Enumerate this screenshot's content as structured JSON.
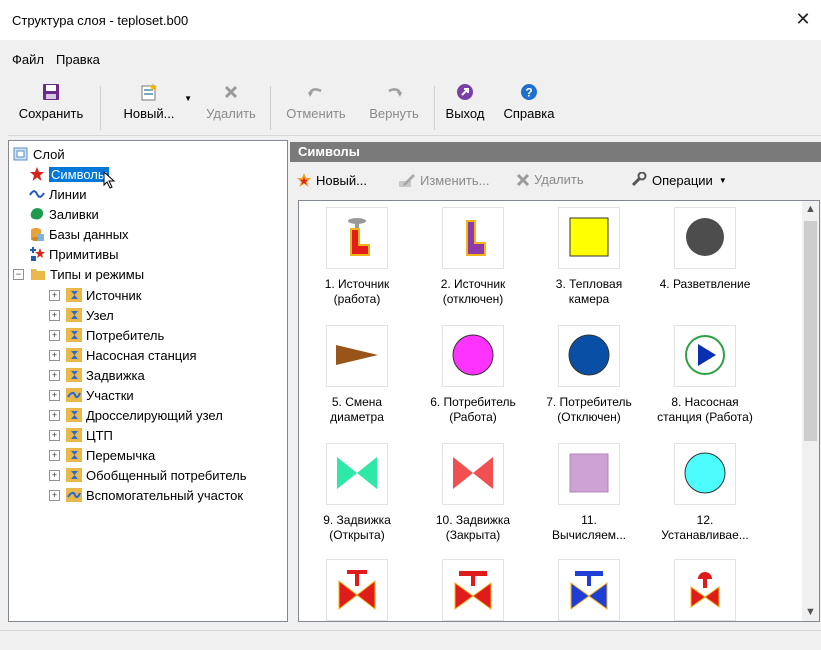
{
  "window": {
    "title": "Структура слоя - teploset.b00",
    "close_glyph": "✕"
  },
  "menu": [
    "Файл",
    "Правка"
  ],
  "toolbar": {
    "save": "Сохранить",
    "new": "Новый...",
    "delete": "Удалить",
    "undo": "Отменить",
    "redo": "Вернуть",
    "exit": "Выход",
    "help": "Справка"
  },
  "tree": {
    "root": "Слой",
    "items": [
      "Символы",
      "Линии",
      "Заливки",
      "Базы данных",
      "Примитивы",
      "Типы и режимы"
    ],
    "types": [
      "Источник",
      "Узел",
      "Потребитель",
      "Насосная станция",
      "Задвижка",
      "Участки",
      "Дросселирующий узел",
      "ЦТП",
      "Перемычка",
      "Обобщенный потребитель",
      "Вспомогательный участок"
    ]
  },
  "panel": {
    "header": "Символы",
    "new": "Новый...",
    "edit": "Изменить...",
    "delete": "Удалить",
    "operations": "Операции"
  },
  "symbols": [
    {
      "l1": "1. Источник",
      "l2": "(работа)"
    },
    {
      "l1": "2. Источник",
      "l2": "(отключен)"
    },
    {
      "l1": "3. Тепловая",
      "l2": "камера"
    },
    {
      "l1": "4. Разветвление",
      "l2": ""
    },
    {
      "l1": "5. Смена",
      "l2": "диаметра"
    },
    {
      "l1": "6. Потребитель",
      "l2": "(Работа)"
    },
    {
      "l1": "7. Потребитель",
      "l2": "(Отключен)"
    },
    {
      "l1": "8. Насосная",
      "l2": "станция (Работа)"
    },
    {
      "l1": "9. Задвижка",
      "l2": "(Открыта)"
    },
    {
      "l1": "10. Задвижка",
      "l2": "(Закрыта)"
    },
    {
      "l1": "11.",
      "l2": "Вычисляем..."
    },
    {
      "l1": "12.",
      "l2": "Устанавливае..."
    }
  ],
  "colors": {
    "selection": "#0078d7",
    "header_bg": "#7a7a7a",
    "accent_blue": "#1e5bb8"
  }
}
